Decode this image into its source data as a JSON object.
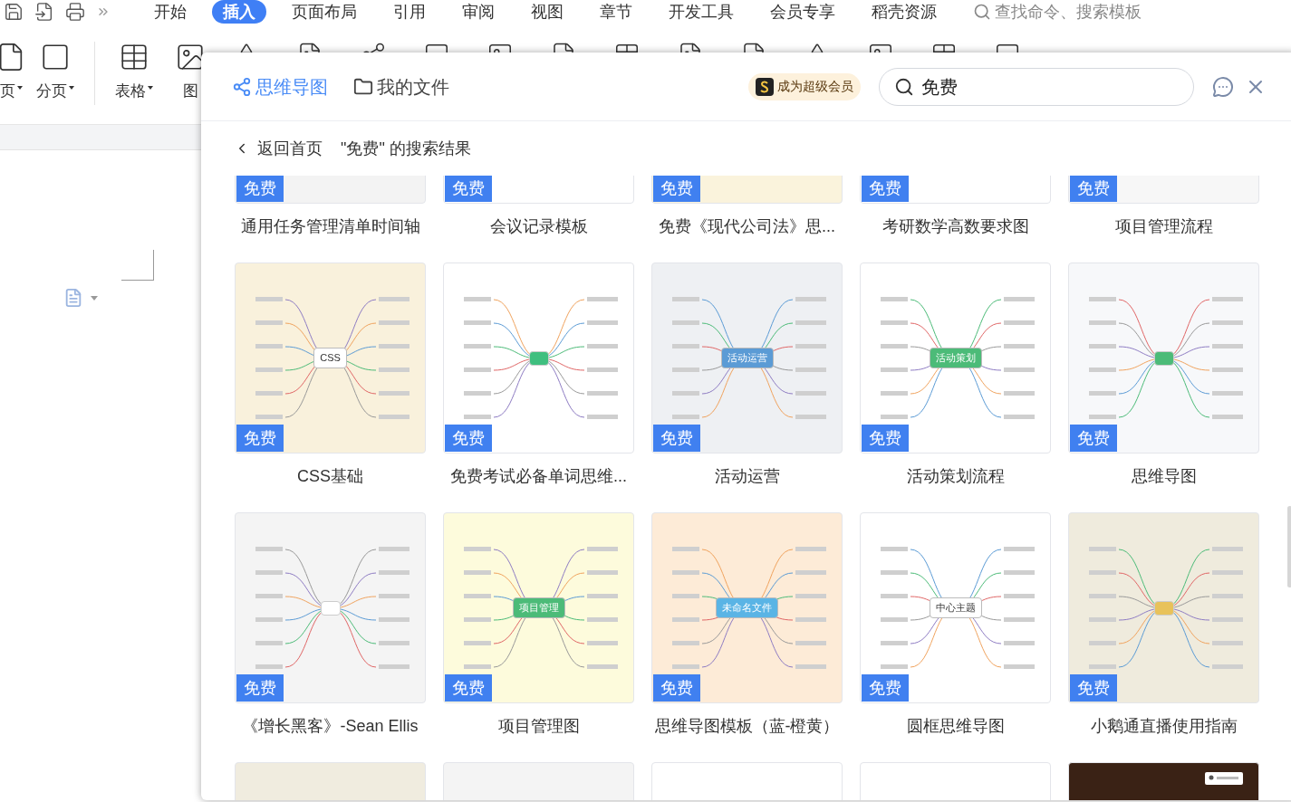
{
  "menu_tabs": [
    {
      "label": "开始",
      "selected": false
    },
    {
      "label": "插入",
      "selected": true
    },
    {
      "label": "页面布局",
      "selected": false
    },
    {
      "label": "引用",
      "selected": false
    },
    {
      "label": "审阅",
      "selected": false
    },
    {
      "label": "视图",
      "selected": false
    },
    {
      "label": "章节",
      "selected": false
    },
    {
      "label": "开发工具",
      "selected": false
    },
    {
      "label": "会员专享",
      "selected": false
    },
    {
      "label": "稻壳资源",
      "selected": false
    }
  ],
  "command_search": {
    "placeholder": "查找命令、搜索模板"
  },
  "ribbon": [
    {
      "label": "页",
      "dropdown": true
    },
    {
      "label": "分页",
      "dropdown": true
    },
    {
      "label": "表格",
      "dropdown": true
    },
    {
      "label": "图",
      "dropdown": false
    }
  ],
  "dialog": {
    "tabs": [
      {
        "label": "思维导图",
        "selected": true
      },
      {
        "label": "我的文件",
        "selected": false
      }
    ],
    "vip_button": "成为超级会员",
    "search": {
      "value": "免费"
    },
    "back_link": "返回首页",
    "results_heading": "\"免费\" 的搜索结果",
    "templates": [
      {
        "title": "通用任务管理清单时间轴",
        "badge": "免费",
        "color": "#f3f3f3"
      },
      {
        "title": "会议记录模板",
        "badge": "免费",
        "color": "#ffffff"
      },
      {
        "title": "免费《现代公司法》思...",
        "badge": "免费",
        "color": "#faf3dc"
      },
      {
        "title": "考研数学高数要求图",
        "badge": "免费",
        "color": "#ffffff"
      },
      {
        "title": "项目管理流程",
        "badge": "免费",
        "color": "#f7f7f7"
      },
      {
        "title": "CSS基础",
        "badge": "免费",
        "color": "#f9f1dc",
        "center": {
          "text": "CSS",
          "color": "#ffffff"
        }
      },
      {
        "title": "免费考试必备单词思维...",
        "badge": "免费",
        "color": "#ffffff",
        "center": {
          "color": "#3fbf7f"
        }
      },
      {
        "title": "活动运营",
        "badge": "免费",
        "color": "#eef0f3",
        "center": {
          "text": "活动运营",
          "color": "#5b9bd5"
        }
      },
      {
        "title": "活动策划流程",
        "badge": "免费",
        "color": "#ffffff",
        "center": {
          "text": "活动策划",
          "color": "#4cbb78"
        }
      },
      {
        "title": "思维导图",
        "badge": "免费",
        "color": "#f7f8fa",
        "center": {
          "color": "#4cbb78"
        }
      },
      {
        "title": "《增长黑客》-Sean Ellis",
        "badge": "免费",
        "color": "#f4f4f4",
        "center": {
          "color": "#ffffff"
        }
      },
      {
        "title": "项目管理图",
        "badge": "免费",
        "color": "#fdfbdc",
        "center": {
          "text": "项目管理",
          "color": "#4cbb78"
        }
      },
      {
        "title": "思维导图模板（蓝-橙黄）",
        "badge": "免费",
        "color": "#fdebd7",
        "center": {
          "text": "未命名文件",
          "color": "#5ab4e5"
        }
      },
      {
        "title": "圆框思维导图",
        "badge": "免费",
        "color": "#ffffff",
        "center": {
          "text": "中心主题",
          "color": "#ffffff"
        }
      },
      {
        "title": "小鹅通直播使用指南",
        "badge": "免费",
        "color": "#efebdd",
        "center": {
          "color": "#e8c25a"
        }
      },
      {
        "color": "#f0ecdf"
      },
      {
        "color": "#f4f4f4"
      },
      {
        "color": "#ffffff"
      },
      {
        "color": "#ffffff"
      },
      {
        "color": "#3a2215"
      }
    ]
  }
}
